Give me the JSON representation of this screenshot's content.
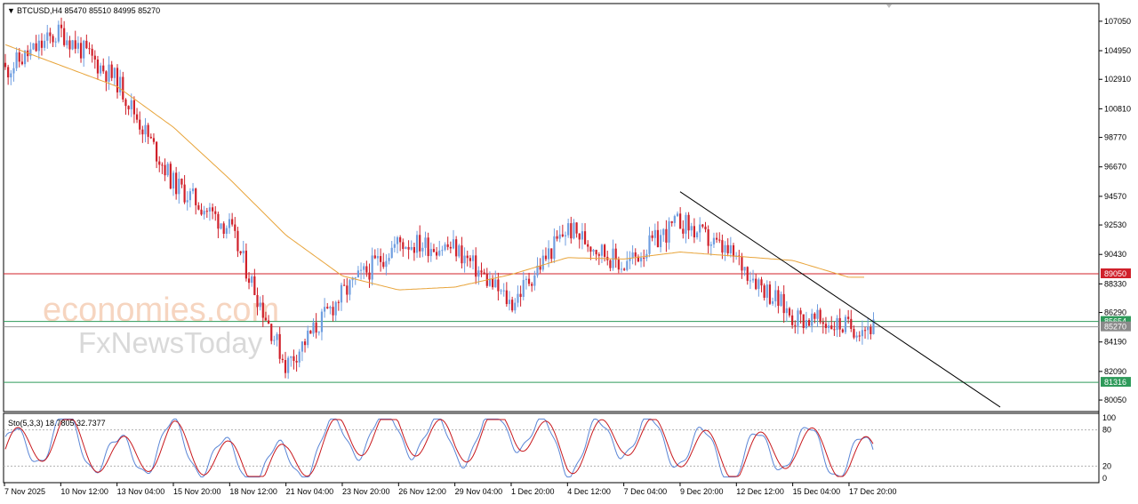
{
  "header": {
    "menu_arrow": "▼",
    "title": "BTCUSD,H4  85470 85510 84995 85270"
  },
  "watermark": {
    "line1": "economies.com",
    "line2": "FxNewsToday"
  },
  "colors": {
    "bull": "#6f9ee0",
    "bear": "#d0202a",
    "ma": "#e8a43a",
    "trendline": "#000000",
    "resistance": "#d0202a",
    "support": "#2e9a5a",
    "current": "#9a9a9a",
    "stoch_main": "#5b86d6",
    "stoch_signal": "#c8191e"
  },
  "price_axis": {
    "ticks": [
      "107050",
      "104950",
      "102910",
      "100810",
      "98770",
      "96670",
      "94570",
      "92530",
      "90430",
      "88330",
      "86290",
      "84190",
      "82090",
      "80050"
    ]
  },
  "levels": {
    "resistance": "89050",
    "support_1": "85654",
    "current": "85270",
    "support_2": "81316"
  },
  "stochastic": {
    "label": "Sto(5,3,3) 18.7805 32.7377",
    "ticks": [
      "100",
      "80",
      "20",
      "0"
    ]
  },
  "time_axis": {
    "labels": [
      "7 Nov 2025",
      "10 Nov 12:00",
      "13 Nov 04:00",
      "15 Nov 20:00",
      "18 Nov 12:00",
      "21 Nov 04:00",
      "23 Nov 20:00",
      "26 Nov 12:00",
      "29 Nov 04:00",
      "1 Dec 20:00",
      "4 Dec 12:00",
      "7 Dec 04:00",
      "9 Dec 20:00",
      "12 Dec 12:00",
      "15 Dec 04:00",
      "17 Dec 20:00"
    ]
  },
  "chart_data": {
    "type": "candlestick",
    "symbol": "BTCUSD",
    "timeframe": "H4",
    "ohlc_last": {
      "open": 85470,
      "high": 85510,
      "low": 84995,
      "close": 85270
    },
    "trend_path": [
      {
        "t": "7 Nov 2025",
        "p": 103500
      },
      {
        "t": "10 Nov 12:00",
        "p": 106300
      },
      {
        "t": "13 Nov 04:00",
        "p": 102800
      },
      {
        "t": "15 Nov 20:00",
        "p": 95500
      },
      {
        "t": "18 Nov 12:00",
        "p": 92300
      },
      {
        "t": "21 Nov 04:00",
        "p": 82500
      },
      {
        "t": "23 Nov 20:00",
        "p": 87600
      },
      {
        "t": "26 Nov 12:00",
        "p": 91300
      },
      {
        "t": "29 Nov 04:00",
        "p": 90900
      },
      {
        "t": "1 Dec 20:00",
        "p": 86900
      },
      {
        "t": "4 Dec 12:00",
        "p": 92300
      },
      {
        "t": "7 Dec 04:00",
        "p": 89600
      },
      {
        "t": "9 Dec 20:00",
        "p": 92800
      },
      {
        "t": "12 Dec 12:00",
        "p": 90100
      },
      {
        "t": "15 Dec 04:00",
        "p": 86000
      },
      {
        "t": "17 Dec 20:00",
        "p": 85270
      }
    ],
    "moving_average_path": [
      {
        "t": "7 Nov 2025",
        "p": 105400
      },
      {
        "t": "13 Nov 04:00",
        "p": 102400
      },
      {
        "t": "15 Nov 20:00",
        "p": 99500
      },
      {
        "t": "18 Nov 12:00",
        "p": 95800
      },
      {
        "t": "21 Nov 04:00",
        "p": 91800
      },
      {
        "t": "23 Nov 20:00",
        "p": 88900
      },
      {
        "t": "26 Nov 12:00",
        "p": 87900
      },
      {
        "t": "29 Nov 04:00",
        "p": 88100
      },
      {
        "t": "1 Dec 20:00",
        "p": 89000
      },
      {
        "t": "4 Dec 12:00",
        "p": 90200
      },
      {
        "t": "7 Dec 04:00",
        "p": 90100
      },
      {
        "t": "9 Dec 20:00",
        "p": 90600
      },
      {
        "t": "12 Dec 12:00",
        "p": 90300
      },
      {
        "t": "15 Dec 04:00",
        "p": 90000
      },
      {
        "t": "17 Dec 20:00",
        "p": 88800
      }
    ],
    "trendline": {
      "from": {
        "t": "9 Dec 20:00",
        "p": 94900
      },
      "to": {
        "t": "17 Dec 20:00",
        "p": 86800
      }
    },
    "horizontal_levels": [
      89050,
      85654,
      85270,
      81316
    ],
    "stochastic_path": [
      {
        "t": "7 Nov 2025",
        "k": 40
      },
      {
        "t": "10 Nov 12:00",
        "k": 75
      },
      {
        "t": "13 Nov 04:00",
        "k": 30
      },
      {
        "t": "15 Nov 20:00",
        "k": 60
      },
      {
        "t": "18 Nov 12:00",
        "k": 25
      },
      {
        "t": "21 Nov 04:00",
        "k": 20
      },
      {
        "t": "23 Nov 20:00",
        "k": 70
      },
      {
        "t": "26 Nov 12:00",
        "k": 80
      },
      {
        "t": "29 Nov 04:00",
        "k": 55
      },
      {
        "t": "1 Dec 20:00",
        "k": 90
      },
      {
        "t": "4 Dec 12:00",
        "k": 40
      },
      {
        "t": "7 Dec 04:00",
        "k": 75
      },
      {
        "t": "9 Dec 20:00",
        "k": 55
      },
      {
        "t": "12 Dec 12:00",
        "k": 30
      },
      {
        "t": "15 Dec 04:00",
        "k": 55
      },
      {
        "t": "17 Dec 20:00",
        "k": 33
      }
    ],
    "stochastic_levels": [
      80,
      20
    ]
  }
}
